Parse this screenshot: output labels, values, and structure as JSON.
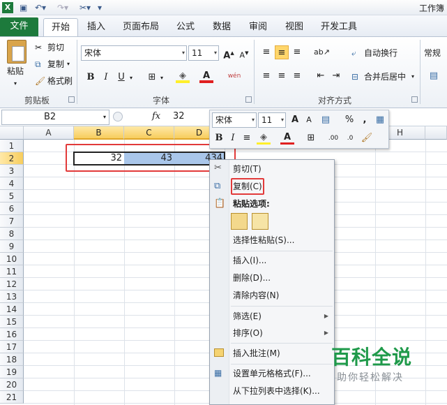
{
  "window": {
    "title": "工作簿"
  },
  "tabs": [
    "文件",
    "开始",
    "插入",
    "页面布局",
    "公式",
    "数据",
    "审阅",
    "视图",
    "开发工具"
  ],
  "clipboard": {
    "paste": "粘贴",
    "cut": "剪切",
    "copy": "复制",
    "format_painter": "格式刷",
    "group": "剪贴板"
  },
  "font": {
    "name": "宋体",
    "size": "11",
    "bold": "B",
    "italic": "I",
    "underline": "U",
    "group": "字体"
  },
  "align": {
    "wrap": "自动换行",
    "merge": "合并后居中",
    "group": "对齐方式"
  },
  "number": {
    "format": "常规"
  },
  "formula_bar": {
    "name_box": "B2",
    "fx": "fx",
    "value": "32"
  },
  "grid": {
    "columns": [
      "A",
      "B",
      "C",
      "D",
      "H"
    ],
    "rows": [
      "1",
      "2",
      "3",
      "4",
      "5",
      "6",
      "7",
      "8",
      "9",
      "10",
      "11",
      "12",
      "13",
      "14",
      "15",
      "16",
      "17",
      "18",
      "19",
      "20",
      "21"
    ],
    "cells": {
      "B2": "32",
      "C2": "43",
      "D2": "434"
    }
  },
  "mini_toolbar": {
    "font": "宋体",
    "size": "11",
    "percent": "%",
    "comma": ","
  },
  "context_menu": {
    "cut": "剪切(T)",
    "copy": "复制(C)",
    "paste_options": "粘贴选项:",
    "paste_special": "选择性粘贴(S)...",
    "insert": "插入(I)...",
    "delete": "删除(D)...",
    "clear": "清除内容(N)",
    "filter": "筛选(E)",
    "sort": "排序(O)",
    "insert_comment": "插入批注(M)",
    "format_cells": "设置单元格格式(F)...",
    "pick_list": "从下拉列表中选择(K)..."
  },
  "watermark": {
    "brand": "百科全说",
    "tagline": "助你轻松解决"
  },
  "colors": {
    "file_tab": "#1d7a3c",
    "highlight": "#e23a3a",
    "watermark": "#1f9a4a"
  }
}
